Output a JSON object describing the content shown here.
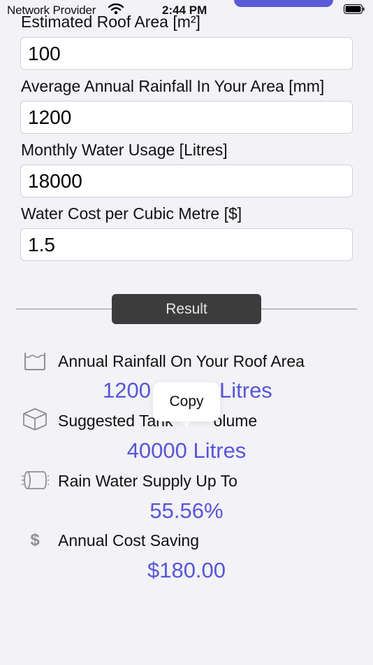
{
  "status": {
    "carrier": "Network Provider",
    "time": "2:44 PM"
  },
  "form": {
    "roof_area_label": "Estimated Roof Area [m²]",
    "roof_area_value": "100",
    "rainfall_label": "Average Annual Rainfall In Your Area [mm]",
    "rainfall_value": "1200",
    "usage_label": "Monthly Water Usage [Litres]",
    "usage_value": "18000",
    "cost_label": "Water Cost per Cubic Metre [$]",
    "cost_value": "1.5"
  },
  "result_button_label": "Result",
  "results": {
    "rainfall_label": "Annual Rainfall On Your Roof Area",
    "rainfall_value": "1200",
    "rainfall_unit": "Litres",
    "tank_label_start": "Suggested Tank",
    "tank_label_end": "olume",
    "tank_value": "40000 Litres",
    "supply_label": "Rain Water Supply Up To",
    "supply_value": "55.56%",
    "saving_label": "Annual Cost Saving",
    "saving_value": "$180.00"
  },
  "popover": {
    "copy_label": "Copy"
  },
  "icons": {
    "roof_rainfall": "container-icon",
    "tank": "cube-icon",
    "supply": "water-pipe-icon",
    "saving": "dollar-icon"
  },
  "colors": {
    "accent": "#5856d6",
    "result_button": "#3c3c3c",
    "background": "#f2f2f7"
  }
}
